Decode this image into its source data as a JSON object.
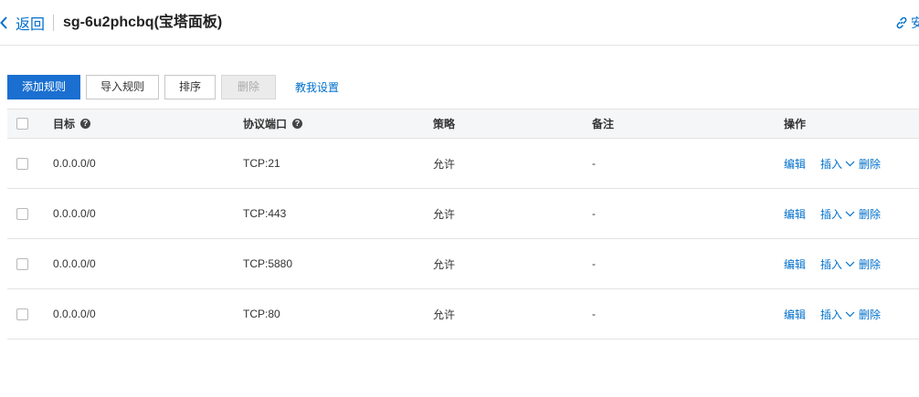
{
  "header": {
    "back_label": "返回",
    "title": "sg-6u2phcbq(宝塔面板)",
    "right_text": "安"
  },
  "toolbar": {
    "add_label": "添加规则",
    "import_label": "导入规则",
    "sort_label": "排序",
    "delete_label": "删除",
    "guide_label": "教我设置"
  },
  "table": {
    "columns": {
      "target": "目标",
      "protocol_port": "协议端口",
      "policy": "策略",
      "remark": "备注",
      "actions": "操作"
    },
    "help_glyph": "?",
    "rows": [
      {
        "target": "0.0.0.0/0",
        "protocol_port": "TCP:21",
        "policy": "允许",
        "remark": "-"
      },
      {
        "target": "0.0.0.0/0",
        "protocol_port": "TCP:443",
        "policy": "允许",
        "remark": "-"
      },
      {
        "target": "0.0.0.0/0",
        "protocol_port": "TCP:5880",
        "policy": "允许",
        "remark": "-"
      },
      {
        "target": "0.0.0.0/0",
        "protocol_port": "TCP:80",
        "policy": "允许",
        "remark": "-"
      }
    ],
    "row_actions": {
      "edit": "编辑",
      "insert": "插入",
      "delete": "删除"
    }
  },
  "icons": {
    "back": "chevron-left-icon",
    "link": "link-icon",
    "help": "question-circle-icon",
    "dropdown": "chevron-down-icon"
  },
  "colors": {
    "accent": "#0070cc",
    "primary_button": "#1a6fd0",
    "header_bg": "#f5f6f8",
    "border": "#e3e3e3"
  }
}
